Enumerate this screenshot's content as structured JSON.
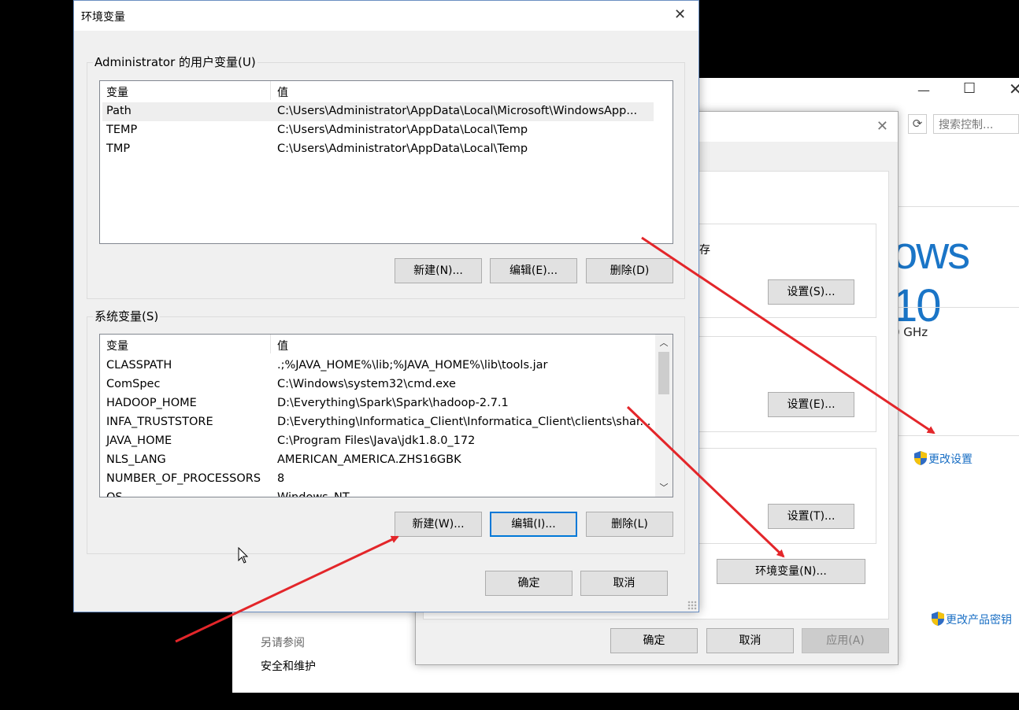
{
  "control_panel": {
    "search_placeholder": "搜索控制...",
    "refresh_icon": "⟳",
    "brand_text": "ows 10",
    "cpu_fragment": "0 GHz",
    "change_settings_link": "更改设置",
    "change_key_link": "更改产品密钥",
    "see_also": "另请参阅",
    "security_link": "安全和维护",
    "accent_color": "#1a75c7"
  },
  "system_properties": {
    "perf_fragment": "存",
    "settings_s": "设置(S)...",
    "settings_e": "设置(E)...",
    "settings_t": "设置(T)...",
    "env_vars_button": "环境变量(N)...",
    "ok": "确定",
    "cancel": "取消",
    "apply": "应用(A)"
  },
  "env_dialog": {
    "title": "环境变量",
    "user_group_label": "Administrator 的用户变量(U)",
    "system_group_label": "系统变量(S)",
    "columns": {
      "name": "变量",
      "value": "值"
    },
    "user_vars": [
      {
        "name": "Path",
        "value": "C:\\Users\\Administrator\\AppData\\Local\\Microsoft\\WindowsApp..."
      },
      {
        "name": "TEMP",
        "value": "C:\\Users\\Administrator\\AppData\\Local\\Temp"
      },
      {
        "name": "TMP",
        "value": "C:\\Users\\Administrator\\AppData\\Local\\Temp"
      }
    ],
    "system_vars": [
      {
        "name": "CLASSPATH",
        "value": ".;%JAVA_HOME%\\lib;%JAVA_HOME%\\lib\\tools.jar"
      },
      {
        "name": "ComSpec",
        "value": "C:\\Windows\\system32\\cmd.exe"
      },
      {
        "name": "HADOOP_HOME",
        "value": "D:\\Everything\\Spark\\Spark\\hadoop-2.7.1"
      },
      {
        "name": "INFA_TRUSTSTORE",
        "value": "D:\\Everything\\Informatica_Client\\Informatica_Client\\clients\\shar..."
      },
      {
        "name": "JAVA_HOME",
        "value": "C:\\Program Files\\Java\\jdk1.8.0_172"
      },
      {
        "name": "NLS_LANG",
        "value": "AMERICAN_AMERICA.ZHS16GBK"
      },
      {
        "name": "NUMBER_OF_PROCESSORS",
        "value": "8"
      },
      {
        "name": "OS",
        "value": "Windows_NT"
      }
    ],
    "user_buttons": {
      "new": "新建(N)...",
      "edit": "编辑(E)...",
      "delete": "删除(D)"
    },
    "system_buttons": {
      "new": "新建(W)...",
      "edit": "编辑(I)...",
      "delete": "删除(L)"
    },
    "ok": "确定",
    "cancel": "取消",
    "arrow_color": "#e3262a"
  }
}
